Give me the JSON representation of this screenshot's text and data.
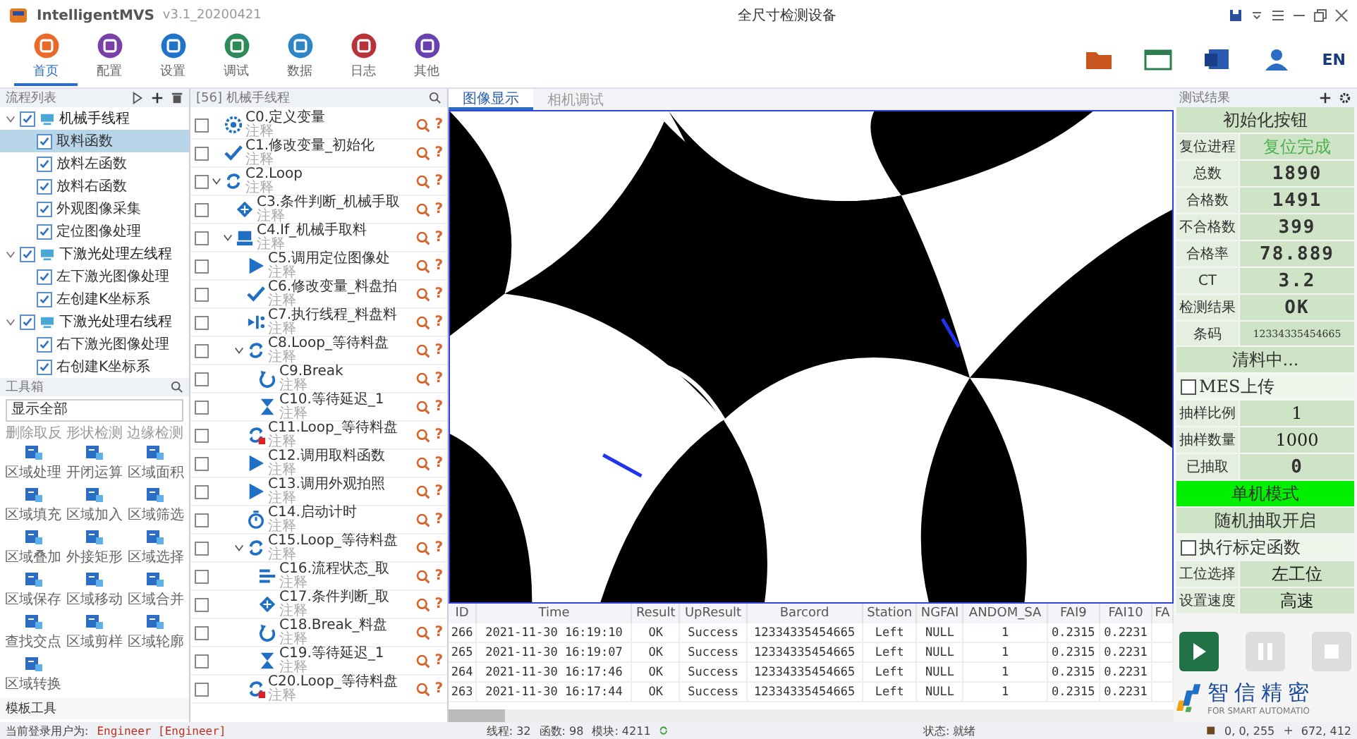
{
  "app": {
    "name": "IntelligentMVS",
    "version": "v3.1_20200421",
    "title": "全尺寸检测设备"
  },
  "ribbon": {
    "items": [
      {
        "label": "首页",
        "color": "#e8692a",
        "selected": true
      },
      {
        "label": "配置",
        "color": "#7b3fa8",
        "selected": false
      },
      {
        "label": "设置",
        "color": "#1f73c8",
        "selected": false
      },
      {
        "label": "调试",
        "color": "#2e8b57",
        "selected": false
      },
      {
        "label": "数据",
        "color": "#2f86c5",
        "selected": false
      },
      {
        "label": "日志",
        "color": "#b8323a",
        "selected": false
      },
      {
        "label": "其他",
        "color": "#6a3fb0",
        "selected": false
      }
    ],
    "language": "EN"
  },
  "process_list": {
    "title": "流程列表",
    "groups": [
      {
        "label": "机械手线程",
        "checked": true,
        "expanded": true,
        "children": [
          {
            "label": "取料函数",
            "checked": true,
            "selected": true
          },
          {
            "label": "放料左函数",
            "checked": true,
            "selected": false
          },
          {
            "label": "放料右函数",
            "checked": true,
            "selected": false
          },
          {
            "label": "外观图像采集",
            "checked": true,
            "selected": false
          },
          {
            "label": "定位图像处理",
            "checked": true,
            "selected": false
          }
        ]
      },
      {
        "label": "下激光处理左线程",
        "checked": true,
        "expanded": true,
        "children": [
          {
            "label": "左下激光图像处理",
            "checked": true,
            "selected": false
          },
          {
            "label": "左创建K坐标系",
            "checked": true,
            "selected": false
          }
        ]
      },
      {
        "label": "下激光处理右线程",
        "checked": true,
        "expanded": true,
        "children": [
          {
            "label": "右下激光图像处理",
            "checked": true,
            "selected": false
          },
          {
            "label": "右创建K坐标系",
            "checked": true,
            "selected": false
          }
        ]
      }
    ]
  },
  "toolbox": {
    "title": "工具箱",
    "filter": "显示全部",
    "partial_labels": [
      "删除取反",
      "形状检测",
      "边缘检测"
    ],
    "tools": [
      {
        "label": "区域处理"
      },
      {
        "label": "开闭运算"
      },
      {
        "label": "区域面积"
      },
      {
        "label": "区域填充"
      },
      {
        "label": "区域加入"
      },
      {
        "label": "区域筛选"
      },
      {
        "label": "区域叠加"
      },
      {
        "label": "外接矩形"
      },
      {
        "label": "区域选择"
      },
      {
        "label": "区域保存"
      },
      {
        "label": "区域移动"
      },
      {
        "label": "区域合并"
      },
      {
        "label": "查找交点"
      },
      {
        "label": "区域剪样"
      },
      {
        "label": "区域轮廓"
      },
      {
        "label": "区域转换"
      }
    ],
    "template_title": "模板工具"
  },
  "flow": {
    "title": "[56] 机械手线程",
    "nodes": [
      {
        "label": "C0.定义变量",
        "note": "注释",
        "kind": "define",
        "checked": false,
        "help": "?"
      },
      {
        "label": "C1.修改变量_初始化",
        "note": "注释",
        "kind": "modify",
        "checked": false,
        "help": "?"
      },
      {
        "label": "C2.Loop",
        "note": "注释",
        "kind": "loop",
        "checked": false,
        "help": "?",
        "expanded": true,
        "children": [
          {
            "label": "C3.条件判断_机械手取",
            "note": "注释",
            "kind": "condition",
            "checked": false,
            "help": "?"
          },
          {
            "label": "C4.If_机械手取料",
            "note": "注释",
            "kind": "if",
            "checked": false,
            "help": "?",
            "expanded": true,
            "children": [
              {
                "label": "C5.调用定位图像处",
                "note": "注释",
                "kind": "call",
                "checked": false,
                "help": "?"
              },
              {
                "label": "C6.修改变量_料盘拍",
                "note": "注释",
                "kind": "modify",
                "checked": false,
                "help": "?"
              },
              {
                "label": "C7.执行线程_料盘料",
                "note": "注释",
                "kind": "run",
                "checked": false,
                "help": "?"
              },
              {
                "label": "C8.Loop_等待料盘",
                "note": "注释",
                "kind": "loop",
                "checked": false,
                "help": "?",
                "expanded": true,
                "children": [
                  {
                    "label": "C9.Break",
                    "note": "注释",
                    "kind": "break",
                    "checked": false,
                    "help": "?"
                  },
                  {
                    "label": "C10.等待延迟_1",
                    "note": "注释",
                    "kind": "wait",
                    "checked": false,
                    "help": "?"
                  }
                ]
              },
              {
                "label": "C11.Loop_等待料盘",
                "note": "注释",
                "kind": "loop_flag",
                "checked": false,
                "help": "?"
              },
              {
                "label": "C12.调用取料函数",
                "note": "注释",
                "kind": "call",
                "checked": false,
                "help": "?"
              },
              {
                "label": "C13.调用外观拍照",
                "note": "注释",
                "kind": "call",
                "checked": false,
                "help": "?"
              },
              {
                "label": "C14.启动计时",
                "note": "注释",
                "kind": "timer",
                "checked": false,
                "help": "?"
              },
              {
                "label": "C15.Loop_等待料盘",
                "note": "注释",
                "kind": "loop",
                "checked": false,
                "help": "?",
                "expanded": true,
                "children": [
                  {
                    "label": "C16.流程状态_取",
                    "note": "注释",
                    "kind": "status",
                    "checked": false,
                    "help": "?"
                  },
                  {
                    "label": "C17.条件判断_取",
                    "note": "注释",
                    "kind": "condition",
                    "checked": false,
                    "help": "?"
                  },
                  {
                    "label": "C18.Break_料盘",
                    "note": "注释",
                    "kind": "break",
                    "checked": false,
                    "help": "?"
                  },
                  {
                    "label": "C19.等待延迟_1",
                    "note": "注释",
                    "kind": "wait",
                    "checked": false,
                    "help": "?"
                  }
                ]
              },
              {
                "label": "C20.Loop_等待料盘",
                "note": "注释",
                "kind": "loop_flag",
                "checked": false,
                "help": "?"
              }
            ]
          }
        ]
      }
    ]
  },
  "viewer": {
    "tabs": [
      {
        "label": "图像显示",
        "selected": true
      },
      {
        "label": "相机调试",
        "selected": false
      }
    ]
  },
  "table": {
    "columns": [
      "ID",
      "Time",
      "Result",
      "UpResult",
      "Barcord",
      "Station",
      "NGFAI",
      "ANDOM_SA",
      "FAI9",
      "FAI10",
      "FA"
    ],
    "rows": [
      [
        "266",
        "2021-11-30 16:19:10",
        "OK",
        "Success",
        "12334335454665",
        "Left",
        "NULL",
        "1",
        "0.2315",
        "0.2231"
      ],
      [
        "265",
        "2021-11-30 16:19:07",
        "OK",
        "Success",
        "12334335454665",
        "Left",
        "NULL",
        "1",
        "0.2315",
        "0.2231"
      ],
      [
        "264",
        "2021-11-30 16:17:46",
        "OK",
        "Success",
        "12334335454665",
        "Left",
        "NULL",
        "1",
        "0.2315",
        "0.2231"
      ],
      [
        "263",
        "2021-11-30 16:17:44",
        "OK",
        "Success",
        "12334335454665",
        "Left",
        "NULL",
        "1",
        "0.2315",
        "0.2231"
      ]
    ]
  },
  "results": {
    "title": "测试结果",
    "rows": [
      {
        "kind": "banner",
        "text": "初始化按钮",
        "active": false
      },
      {
        "kind": "text_field",
        "label": "复位进程",
        "value": "复位完成",
        "color": "#4cb04c"
      },
      {
        "kind": "digit_field",
        "label": "总数",
        "value": "1890"
      },
      {
        "kind": "digit_field",
        "label": "合格数",
        "value": "1491"
      },
      {
        "kind": "digit_field",
        "label": "不合格数",
        "value": "399"
      },
      {
        "kind": "digit_field",
        "label": "合格率",
        "value": "78.889"
      },
      {
        "kind": "digit_field",
        "label": "CT",
        "value": "3.2"
      },
      {
        "kind": "digit_field",
        "label": "检测结果",
        "value": "OK"
      },
      {
        "kind": "barcode",
        "label": "条码",
        "value": "12334335454665"
      },
      {
        "kind": "banner",
        "text": "清料中...",
        "active": false
      },
      {
        "kind": "check",
        "text": "MES上传",
        "checked": false
      },
      {
        "kind": "text_field",
        "label": "抽样比例",
        "value": "1",
        "color": "#1a1a1a"
      },
      {
        "kind": "text_field",
        "label": "抽样数量",
        "value": "1000",
        "color": "#1a1a1a"
      },
      {
        "kind": "digit_field",
        "label": "已抽取",
        "value": "0"
      },
      {
        "kind": "banner",
        "text": "单机模式",
        "active": true
      },
      {
        "kind": "banner",
        "text": "随机抽取开启",
        "active": false
      },
      {
        "kind": "check",
        "text": "执行标定函数",
        "checked": false
      },
      {
        "kind": "text_field",
        "label": "工位选择",
        "value": "左工位",
        "color": "#1a1a1a"
      },
      {
        "kind": "text_field",
        "label": "设置速度",
        "value": "高速",
        "color": "#1a1a1a"
      }
    ]
  },
  "controls": [
    {
      "kind": "play",
      "enabled": true
    },
    {
      "kind": "pause",
      "enabled": false
    },
    {
      "kind": "stop",
      "enabled": false
    }
  ],
  "logo": {
    "name": "智信精密",
    "tagline": "FOR SMART AUTOMATIO"
  },
  "status_bar": {
    "user_label": "当前登录用户为:",
    "user": "Engineer [Engineer]",
    "threads": "线程: 32",
    "functions": "函数: 98",
    "modules": "模块: 4211",
    "state": "状态: 就绪",
    "pixel_value": "0, 0, 255",
    "cursor": "672, 412"
  }
}
